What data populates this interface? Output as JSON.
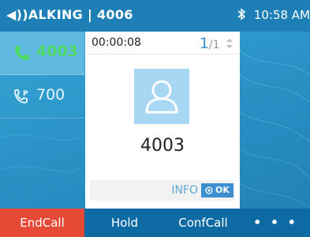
{
  "status": {
    "title": "◀))ALKING | 4006",
    "time": "10:58 AM",
    "bluetooth_icon": "bluetooth-icon"
  },
  "lines": [
    {
      "label": "4003",
      "icon": "phone-active-icon",
      "color": "#4cd964"
    },
    {
      "label": "700",
      "icon": "phone-park-icon"
    }
  ],
  "call": {
    "timer": "00:00:08",
    "page_current": "1",
    "page_total": "/1",
    "number": "4003",
    "info_label": "INFO",
    "ok_label": "OK"
  },
  "softkeys": {
    "end": "EndCall",
    "hold": "Hold",
    "conf": "ConfCall",
    "more": "• • •"
  },
  "colors": {
    "end_red": "#e64a36",
    "accent_blue": "#3c8fd0",
    "active_green": "#4cd964"
  }
}
